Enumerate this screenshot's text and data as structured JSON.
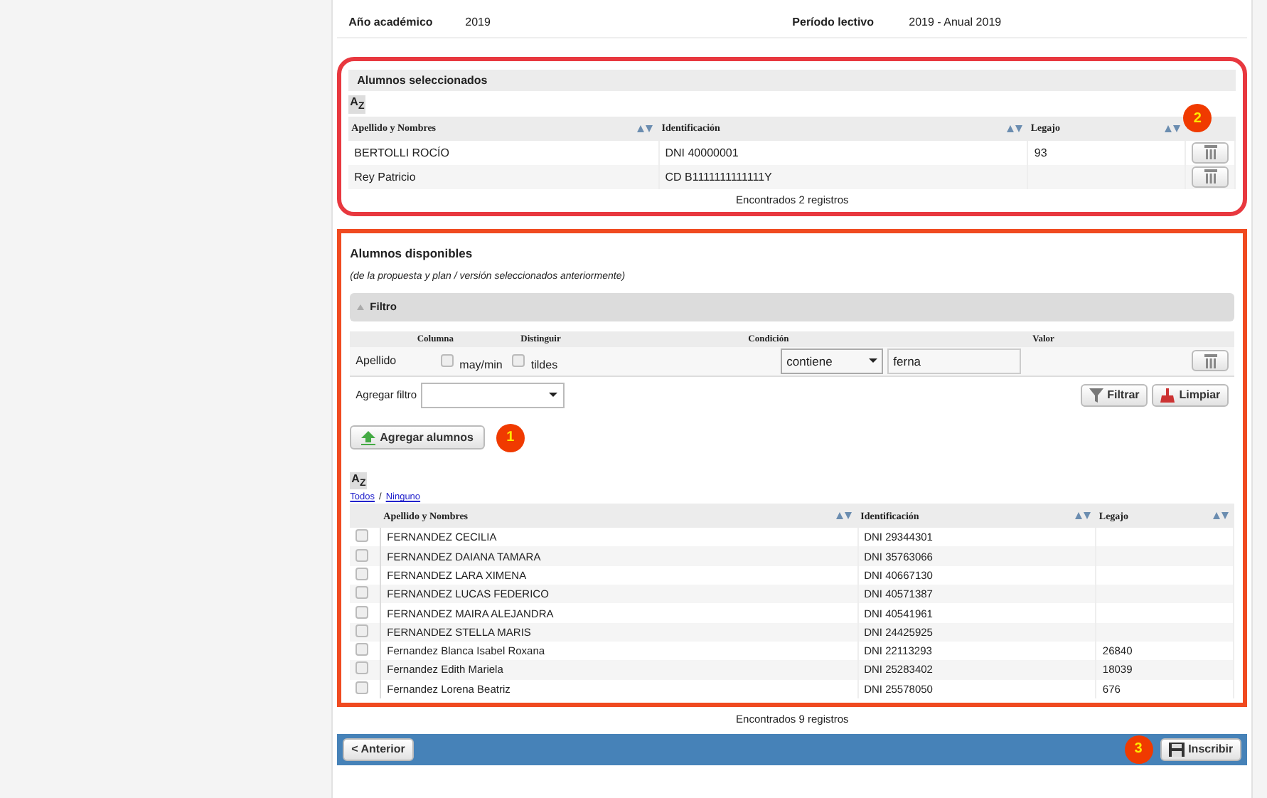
{
  "info": [
    {
      "label": "Año académico",
      "value": "2019"
    },
    {
      "label": "Período lectivo",
      "value": "2019 - Anual 2019"
    }
  ],
  "selected_panel": {
    "title": "Alumnos seleccionados",
    "badge": "2",
    "columns": [
      "Apellido y Nombres",
      "Identificación",
      "Legajo"
    ],
    "sort_icon": "A$_{Z}$",
    "rows": [
      {
        "name": "BERTOLLI ROCÍO",
        "id": "DNI 40000001",
        "legajo": "93"
      },
      {
        "name": "Rey Patricio",
        "id": "CD B1111111111111Y",
        "legajo": ""
      }
    ],
    "footer": "Encontrados 2 registros"
  },
  "available_panel": {
    "title": "Alumnos disponibles",
    "subtitle": "(de la propuesta y plan / versión seleccionados anteriormente)",
    "filter": {
      "title": "Filtro",
      "expanded": true,
      "columns": [
        "Columna",
        "Distinguir",
        "Condición",
        "Valor"
      ],
      "row": {
        "column": "Apellido",
        "case_label": "may/min",
        "case_checked": false,
        "accent_label": "tildes",
        "accent_checked": false,
        "condition": "contiene",
        "value": "ferna"
      },
      "add_label": "Agregar filtro",
      "filter_button": "Filtrar",
      "clear_button": "Limpiar"
    },
    "add_button": "Agregar alumnos",
    "add_badge": "1",
    "sort_icon": "A$_{Z}$",
    "select_all": "Todos",
    "separator": "/",
    "select_none": "Ninguno",
    "columns": [
      "Apellido y Nombres",
      "Identificación",
      "Legajo"
    ],
    "rows": [
      {
        "name": "FERNANDEZ CECILIA",
        "id": "DNI 29344301",
        "legajo": "",
        "checked": false
      },
      {
        "name": "FERNANDEZ DAIANA TAMARA",
        "id": "DNI 35763066",
        "legajo": "",
        "checked": false
      },
      {
        "name": "FERNANDEZ LARA XIMENA",
        "id": "DNI 40667130",
        "legajo": "",
        "checked": false
      },
      {
        "name": "FERNANDEZ LUCAS FEDERICO",
        "id": "DNI 40571387",
        "legajo": "",
        "checked": false
      },
      {
        "name": "FERNANDEZ MAIRA ALEJANDRA",
        "id": "DNI 40541961",
        "legajo": "",
        "checked": false
      },
      {
        "name": "FERNANDEZ STELLA MARIS",
        "id": "DNI 24425925",
        "legajo": "",
        "checked": false
      },
      {
        "name": "Fernandez Blanca Isabel Roxana",
        "id": "DNI 22113293",
        "legajo": "26840",
        "checked": false
      },
      {
        "name": "Fernandez Edith Mariela",
        "id": "DNI 25283402",
        "legajo": "18039",
        "checked": false
      },
      {
        "name": "Fernandez Lorena Beatriz",
        "id": "DNI 25578050",
        "legajo": "676",
        "checked": false
      }
    ]
  },
  "footer": "Encontrados 9 registros",
  "nav": {
    "back": "< Anterior",
    "submit": "Inscribir",
    "badge": "3"
  }
}
